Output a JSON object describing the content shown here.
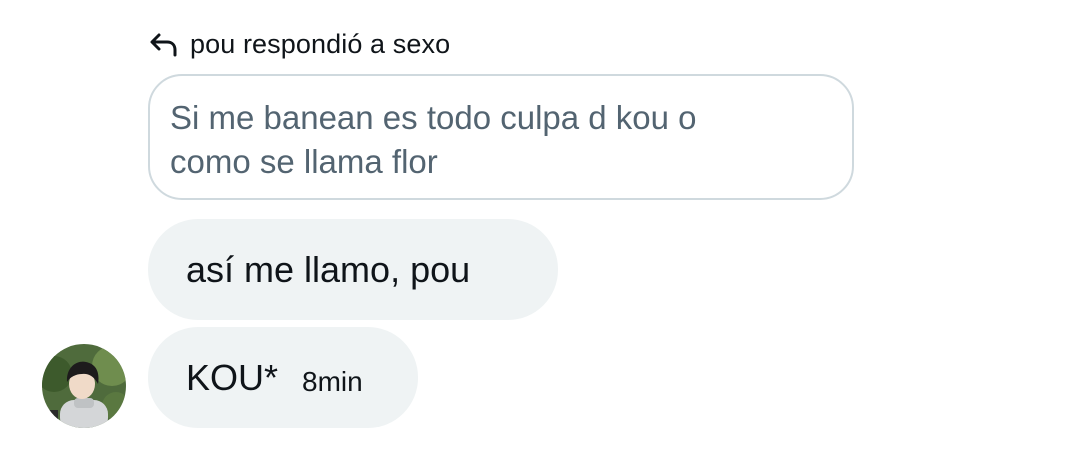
{
  "reply_header": {
    "icon": "reply-arrow-icon",
    "text": "pou respondió a sexo"
  },
  "quoted_message": {
    "line1": "Si me banean es todo culpa d kou o",
    "line2": "como se llama flor"
  },
  "messages": [
    {
      "text": "así me llamo, pou"
    },
    {
      "text": "KOU*",
      "timestamp": "8min"
    }
  ],
  "avatar": {
    "icon": "user-avatar"
  },
  "colors": {
    "bubble_bg": "#eff3f4",
    "quote_border": "#cfd9de",
    "quote_text": "#536471",
    "text": "#0f1419"
  }
}
